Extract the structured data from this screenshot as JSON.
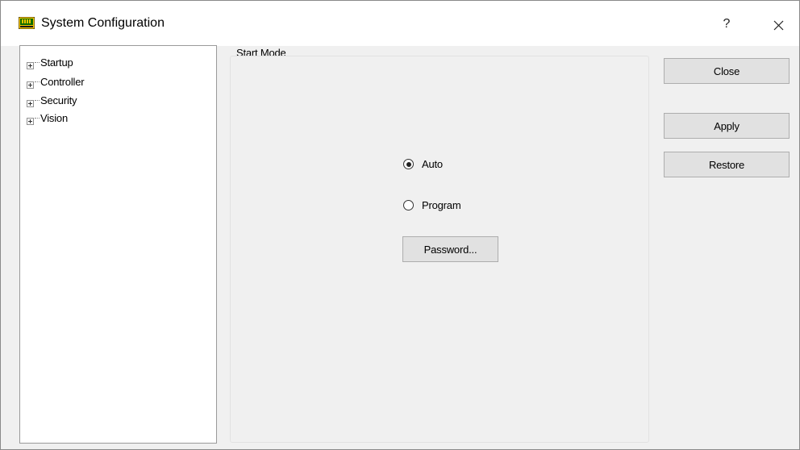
{
  "window": {
    "title": "System Configuration",
    "help_label": "?"
  },
  "tree": {
    "items": [
      {
        "label": "Startup"
      },
      {
        "label": "Controller"
      },
      {
        "label": "Security"
      },
      {
        "label": "Vision"
      }
    ]
  },
  "start_mode": {
    "group_label": "Start Mode",
    "options": [
      {
        "label": "Auto",
        "selected": true
      },
      {
        "label": "Program",
        "selected": false
      }
    ],
    "password_button": "Password..."
  },
  "actions": {
    "close_label": "Close",
    "apply_label": "Apply",
    "restore_label": "Restore"
  },
  "colors": {
    "app_icon_body": "#f5c400",
    "app_icon_screen": "#0a6b00",
    "window_background": "#f0f0f0",
    "button_background": "#e1e1e1"
  },
  "icons": {
    "app": "monitor-icon",
    "help": "help-icon",
    "close": "close-icon",
    "expander": "plus-box-icon"
  }
}
